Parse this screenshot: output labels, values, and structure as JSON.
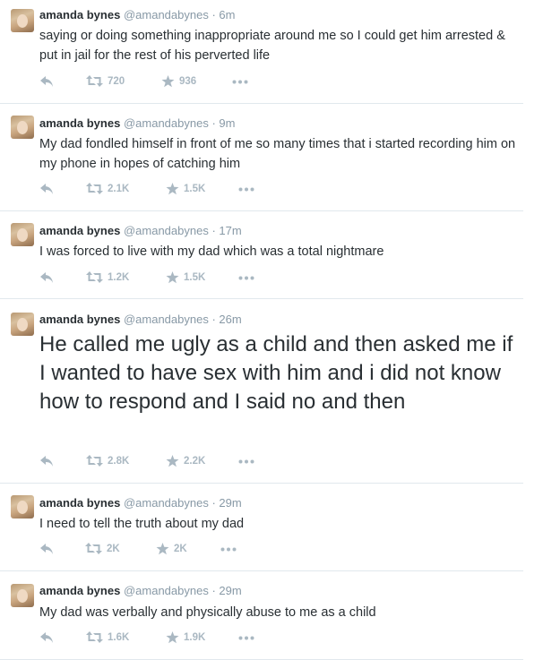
{
  "user": {
    "name": "amanda bynes",
    "handle": "@amandabynes",
    "separator": "·"
  },
  "colors": {
    "text": "#292f33",
    "meta": "#8899a6",
    "icons": "#aab8c2",
    "divider": "#e1e8ed"
  },
  "icons": {
    "reply": "reply-arrow",
    "retweet": "retweet-arrows",
    "favorite": "star",
    "more": "ellipsis"
  },
  "tweets": [
    {
      "time": "6m",
      "text": "saying or doing something inappropriate around me so I could get him arrested & put in jail for the rest of his perverted life",
      "retweets": "720",
      "favorites": "936"
    },
    {
      "time": "9m",
      "text": "My dad fondled himself in front of me so many times that i started recording him on my phone in hopes of catching him",
      "retweets": "2.1K",
      "favorites": "1.5K"
    },
    {
      "time": "17m",
      "text": "I was forced to live with my dad which was a total nightmare",
      "retweets": "1.2K",
      "favorites": "1.5K"
    },
    {
      "time": "26m",
      "text": "He called me ugly as a child and then asked me if I wanted to have sex with him and i did not know how to respond and I said no and then",
      "retweets": "2.8K",
      "favorites": "2.2K"
    },
    {
      "time": "29m",
      "text": "I need to tell the truth about my dad",
      "retweets": "2K",
      "favorites": "2K"
    },
    {
      "time": "29m",
      "text": "My dad was verbally and physically abuse to me as a child",
      "retweets": "1.6K",
      "favorites": "1.9K"
    }
  ]
}
